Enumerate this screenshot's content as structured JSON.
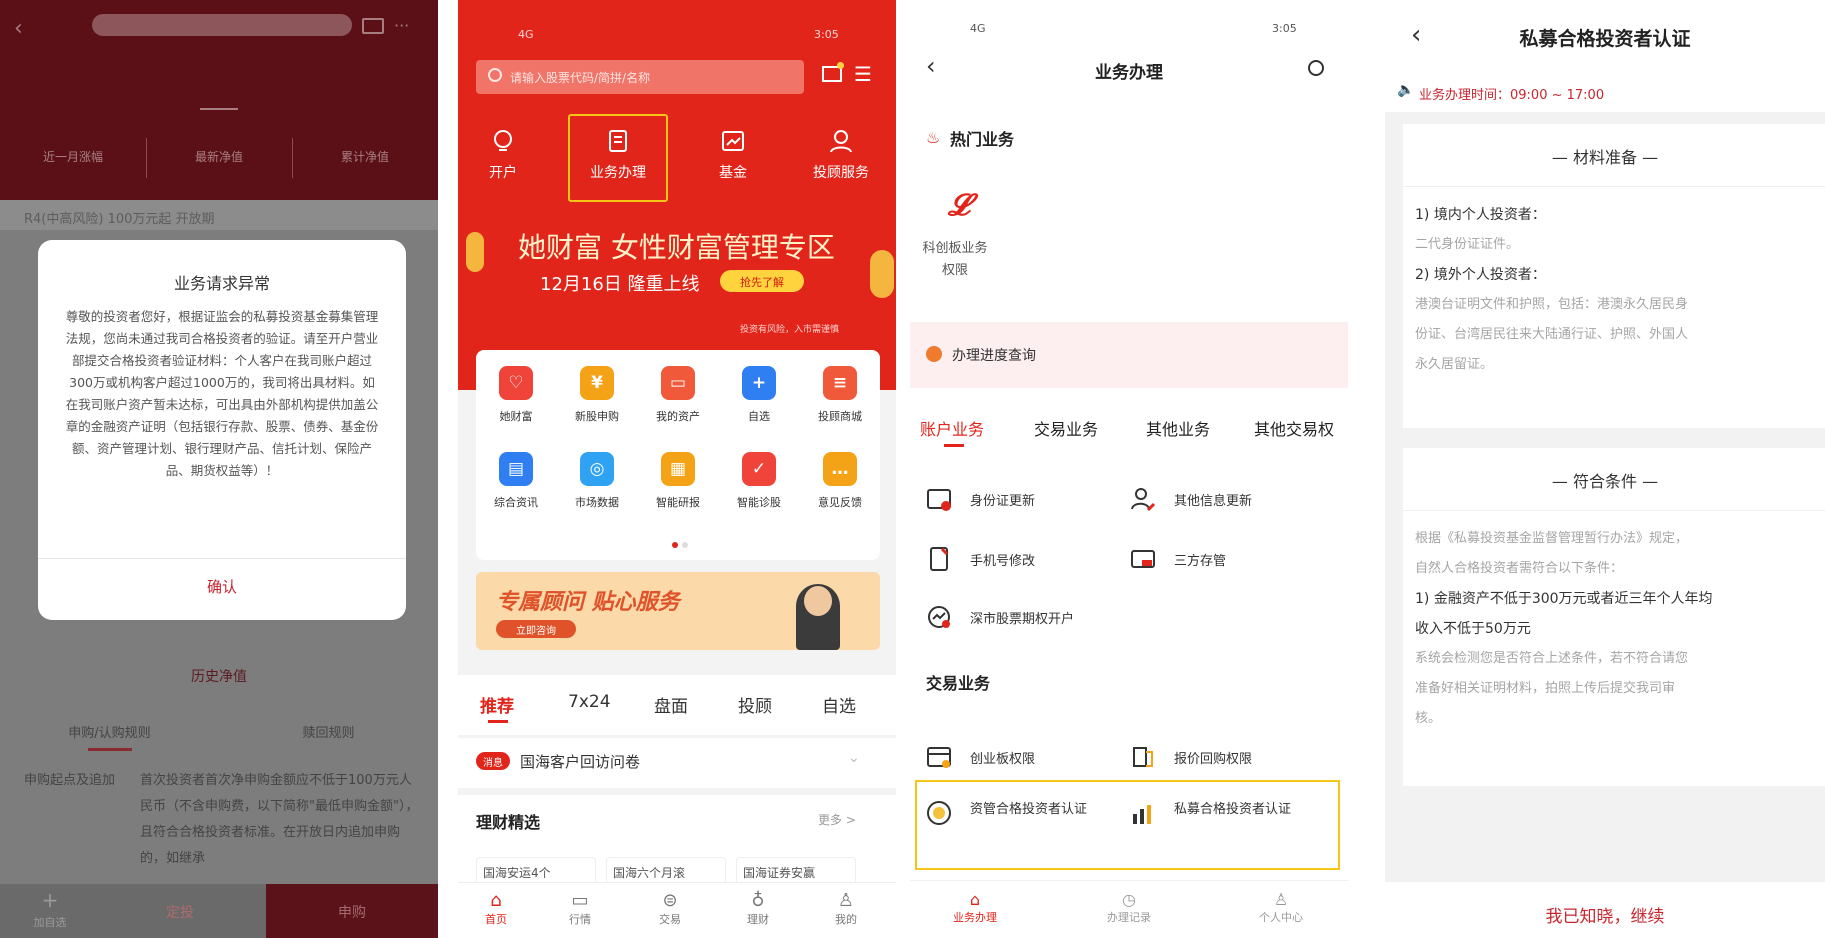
{
  "panel1": {
    "header_title": "",
    "stats": [
      "近一月涨幅",
      "最新净值",
      "累计净值"
    ],
    "risk_line": "R4(中高风险)  100万元起  开放期",
    "modal": {
      "title": "业务请求异常",
      "body": "尊敬的投资者您好，根据证监会的私募投资基金募集管理法规，您尚未通过我司合格投资者的验证。请至开户营业部提交合格投资者验证材料：个人客户在我司账户超过300万或机构客户超过1000万的，我司将出具材料。如在我司账户资产暂未达标，可出具由外部机构提供加盖公章的金融资产证明（包括银行存款、股票、债券、基金份额、资产管理计划、银行理财产品、信托计划、保险产品、期货权益等）！",
      "confirm": "确认"
    },
    "history": "历史净值",
    "subtabs": [
      "申购/认购规则",
      "赎回规则"
    ],
    "rule_label": "申购起点及追加",
    "rule_text": "首次投资者首次净申购金额应不低于100万元人民币（不含申购费，以下简称\"最低申购金额\"），且符合合格投资者标准。在开放日内追加申购的，如继承",
    "bottom": {
      "add": "加自选",
      "mid": "定投",
      "buy": "申购"
    }
  },
  "panel2": {
    "status_signal": "4G",
    "status_time": "3:05",
    "search_placeholder": "请输入股票代码/简拼/名称",
    "nav": [
      "开户",
      "业务办理",
      "基金",
      "投顾服务"
    ],
    "banner": {
      "title": "她财富 女性财富管理专区",
      "subtitle": "12月16日 隆重上线",
      "button": "抢先了解",
      "fine": "投资有风险，入市需谨慎"
    },
    "grid": [
      {
        "label": "她财富",
        "color": "#f0443a",
        "glyph": "♡"
      },
      {
        "label": "新股申购",
        "color": "#f4a316",
        "glyph": "¥"
      },
      {
        "label": "我的资产",
        "color": "#f05a3a",
        "glyph": "▭"
      },
      {
        "label": "自选",
        "color": "#2f7ef2",
        "glyph": "+"
      },
      {
        "label": "投顾商城",
        "color": "#f05a3a",
        "glyph": "≡"
      },
      {
        "label": "综合资讯",
        "color": "#2f7ef2",
        "glyph": "▤"
      },
      {
        "label": "市场数据",
        "color": "#2fa3f2",
        "glyph": "◎"
      },
      {
        "label": "智能研报",
        "color": "#f4a316",
        "glyph": "▦"
      },
      {
        "label": "智能诊股",
        "color": "#f0443a",
        "glyph": "✓"
      },
      {
        "label": "意见反馈",
        "color": "#f4a316",
        "glyph": "…"
      }
    ],
    "advisor": {
      "title": "专属顾问 贴心服务",
      "button": "立即咨询"
    },
    "tabs": [
      "推荐",
      "7x24",
      "盘面",
      "投顾",
      "自选"
    ],
    "news": {
      "badge": "消息",
      "text": "国海客户回访问卷"
    },
    "lczx": {
      "title": "理财精选",
      "more": "更多 >",
      "items": [
        "国海安运4个",
        "国海六个月滚",
        "国海证券安赢"
      ]
    },
    "tabbar": [
      "首页",
      "行情",
      "交易",
      "理财",
      "我的"
    ]
  },
  "panel3": {
    "status_signal": "4G",
    "status_time": "3:05",
    "title": "业务办理",
    "hot_title": "热门业务",
    "hot_item": "科创板业务\n权限",
    "progress": "办理进度查询",
    "acc_tabs": [
      "账户业务",
      "交易业务",
      "其他业务",
      "其他交易权"
    ],
    "account_items": [
      "身份证更新",
      "其他信息更新",
      "手机号修改",
      "三方存管",
      "深市股票期权开户"
    ],
    "trade_title": "交易业务",
    "trade_items": [
      "创业板权限",
      "报价回购权限",
      "资管合格投资者认证",
      "私募合格投资者认证"
    ],
    "tabbar": [
      "业务办理",
      "办理记录",
      "个人中心"
    ]
  },
  "panel4": {
    "title": "私募合格投资者认证",
    "notice": "业务办理时间：09:00 ~ 17:00",
    "materials": {
      "title": "— 材料准备 —",
      "lines": [
        {
          "t": "1) 境内个人投资者：",
          "b": true
        },
        {
          "t": "二代身份证证件。",
          "b": false
        },
        {
          "t": "2) 境外个人投资者：",
          "b": true
        },
        {
          "t": "港澳台证明文件和护照，包括：港澳永久居民身",
          "b": false
        },
        {
          "t": "份证、台湾居民往来大陆通行证、护照、外国人",
          "b": false
        },
        {
          "t": "永久居留证。",
          "b": false
        }
      ]
    },
    "conditions": {
      "title": "— 符合条件 —",
      "lines": [
        {
          "t": "根据《私募投资基金监督管理暂行办法》规定，",
          "b": false
        },
        {
          "t": "自然人合格投资者需符合以下条件：",
          "b": false
        },
        {
          "t": "1) 金融资产不低于300万元或者近三年个人年均",
          "b": true
        },
        {
          "t": "收入不低于50万元",
          "b": true
        },
        {
          "t": "系统会检测您是否符合上述条件，若不符合请您",
          "b": false
        },
        {
          "t": "准备好相关证明材料，拍照上传后提交我司审",
          "b": false
        },
        {
          "t": "核。",
          "b": false
        }
      ]
    },
    "confirm": "我已知晓，继续"
  }
}
